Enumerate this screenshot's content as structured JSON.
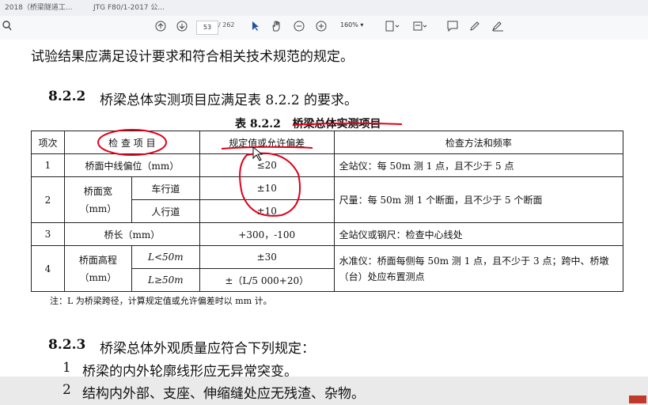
{
  "tabs": [
    {
      "label": "2018（桥梁隧道工..."
    },
    {
      "label": "JTG F80/1-2017 公..."
    }
  ],
  "toolbar": {
    "page_current": "53",
    "page_total": "/ 262",
    "zoom": "160%"
  },
  "document": {
    "line1": "试验结果应满足设计要求和符合相关技术规范的规定。",
    "section_822_num": "8.2.2",
    "section_822_text": "桥梁总体实测项目应满足表 8.2.2 的要求。",
    "table_title_num": "表 8.2.2",
    "table_title_text": "桥梁总体实测项目",
    "table": {
      "headers": [
        "项次",
        "检 查 项 目",
        "规定值或允许偏差",
        "检查方法和频率"
      ],
      "rows": [
        {
          "no": "1",
          "item": "桥面中线偏位（mm）",
          "sub": "",
          "value": "≤20",
          "method": "全站仪：每 50m 测 1 点，且不少于 5 点"
        },
        {
          "no": "2",
          "item": "桥面宽（mm）",
          "sub": "车行道",
          "value": "±10",
          "method": "尺量：每 50m 测 1 个断面，且不少于 5 个断面"
        },
        {
          "no": "",
          "item": "",
          "sub": "人行道",
          "value": "±10",
          "method": ""
        },
        {
          "no": "3",
          "item": "桥长（mm）",
          "sub": "",
          "value": "+300，-100",
          "method": "全站仪或钢尺：检查中心线处"
        },
        {
          "no": "4",
          "item": "桥面高程（mm）",
          "sub": "L<50m",
          "value": "±30",
          "method": "水准仪：桥面每侧每 50m 测 1 点，且不少于 3 点；跨中、桥墩（台）处应布置测点"
        },
        {
          "no": "",
          "item": "",
          "sub": "L≥50m",
          "value": "±（L/5 000+20）",
          "method": ""
        }
      ],
      "item_1": "桥面中线偏位（mm）",
      "item_2a": "桥面宽",
      "item_2b": "（mm）",
      "item_4a": "桥面高程",
      "item_4b": "（mm）"
    },
    "note": "注：L 为桥梁跨径，计算规定值或允许偏差时以 mm 计。",
    "section_823_num": "8.2.3",
    "section_823_text": "桥梁总体外观质量应符合下列规定：",
    "item1_num": "1",
    "item1_text": "桥梁的内外轮廓线形应无异常突变。",
    "item2_num": "2",
    "item2_text": "结构内外部、支座、伸缩缝处应无残渣、杂物。"
  },
  "colors": {
    "annotation_red": "#e0001a",
    "toolbar_bg": "#f7f8fa"
  }
}
